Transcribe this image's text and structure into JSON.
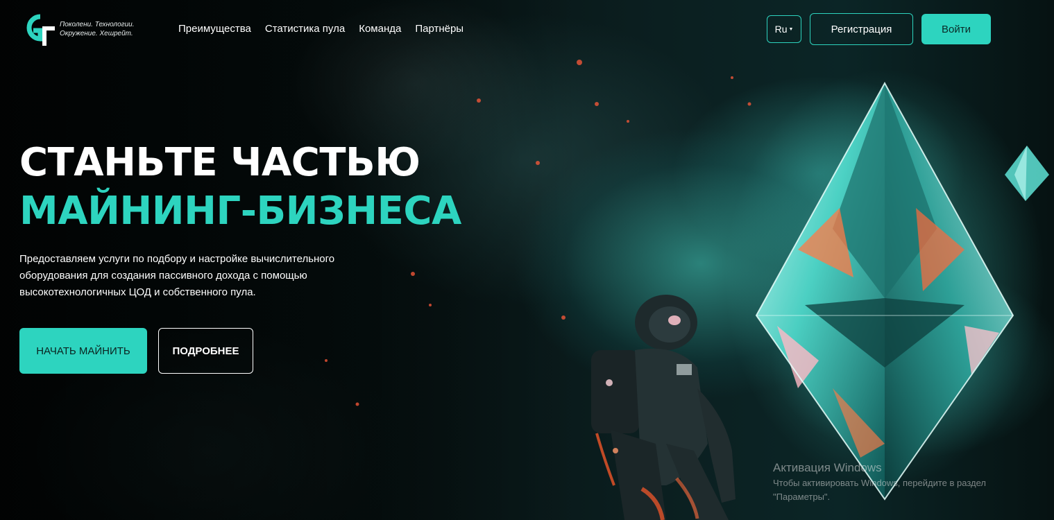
{
  "header": {
    "logo": {
      "tagline_line1": "Поколени. Технологии.",
      "tagline_line2": "Окружение. Хешрейт."
    },
    "nav": [
      {
        "label": "Преимущества"
      },
      {
        "label": "Статистика пула"
      },
      {
        "label": "Команда"
      },
      {
        "label": "Партнёры"
      }
    ],
    "language": {
      "selected": "Ru"
    },
    "register_label": "Регистрация",
    "login_label": "Войти"
  },
  "hero": {
    "title_line1": "СТАНЬТЕ ЧАСТЬЮ",
    "title_line2": "МАЙНИНГ-БИЗНЕСА",
    "description": "Предоставляем услуги по подбору и настройке вычислительного оборудования для создания пассивного дохода с помощью высокотехнологичных ЦОД и собственного пула.",
    "start_button": "НАЧАТЬ МАЙНИТЬ",
    "more_button": "ПОДРОБНЕЕ"
  },
  "watermark": {
    "title": "Активация Windows",
    "text": "Чтобы активировать Windows, перейдите в раздел \"Параметры\"."
  },
  "colors": {
    "accent": "#2dd4bf",
    "background": "#050a0a",
    "text": "#ffffff"
  }
}
